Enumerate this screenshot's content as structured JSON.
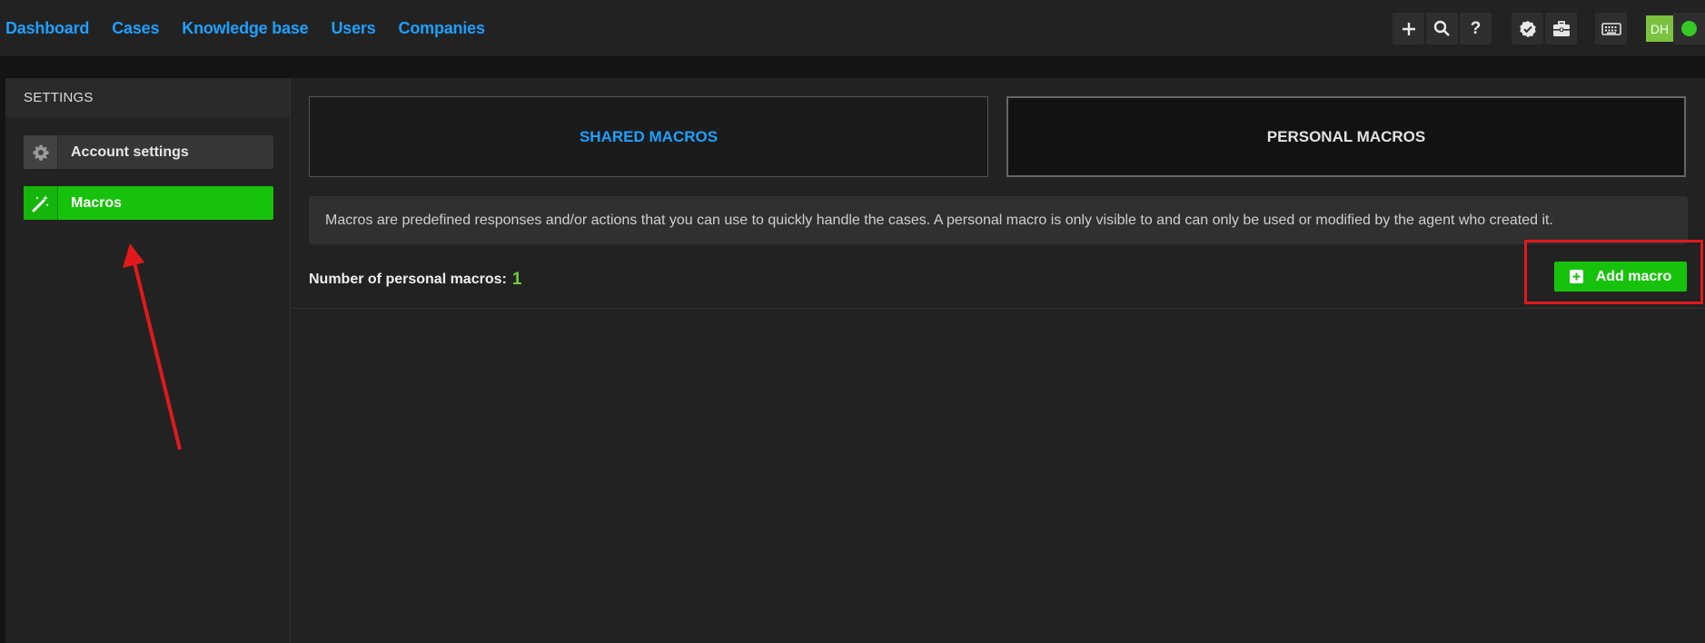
{
  "nav": {
    "items": [
      "Dashboard",
      "Cases",
      "Knowledge base",
      "Users",
      "Companies"
    ]
  },
  "toolbar": {
    "icons": [
      "plus-icon",
      "search-icon",
      "help-icon",
      "verified-badge-icon",
      "briefcase-icon",
      "keyboard-icon"
    ],
    "help_label": "?",
    "avatar_initials": "DH",
    "status_color": "#34c924"
  },
  "sidebar": {
    "header": "SETTINGS",
    "items": [
      {
        "label": "Account settings",
        "icon": "gear-icon",
        "active": false
      },
      {
        "label": "Macros",
        "icon": "magic-wand-icon",
        "active": true
      }
    ]
  },
  "main": {
    "tabs": [
      {
        "label": "SHARED MACROS",
        "active": false
      },
      {
        "label": "PERSONAL MACROS",
        "active": true
      }
    ],
    "info_text": "Macros are predefined responses and/or actions that you can use to quickly handle the cases. A personal macro is only visible to and can only be used or modified by the agent who created it.",
    "count_label": "Number of personal macros:",
    "count_value": "1",
    "add_button_label": "Add macro"
  },
  "colors": {
    "accent_blue": "#1ea0ff",
    "accent_green": "#17c20c",
    "annotation_red": "#e0191c"
  }
}
